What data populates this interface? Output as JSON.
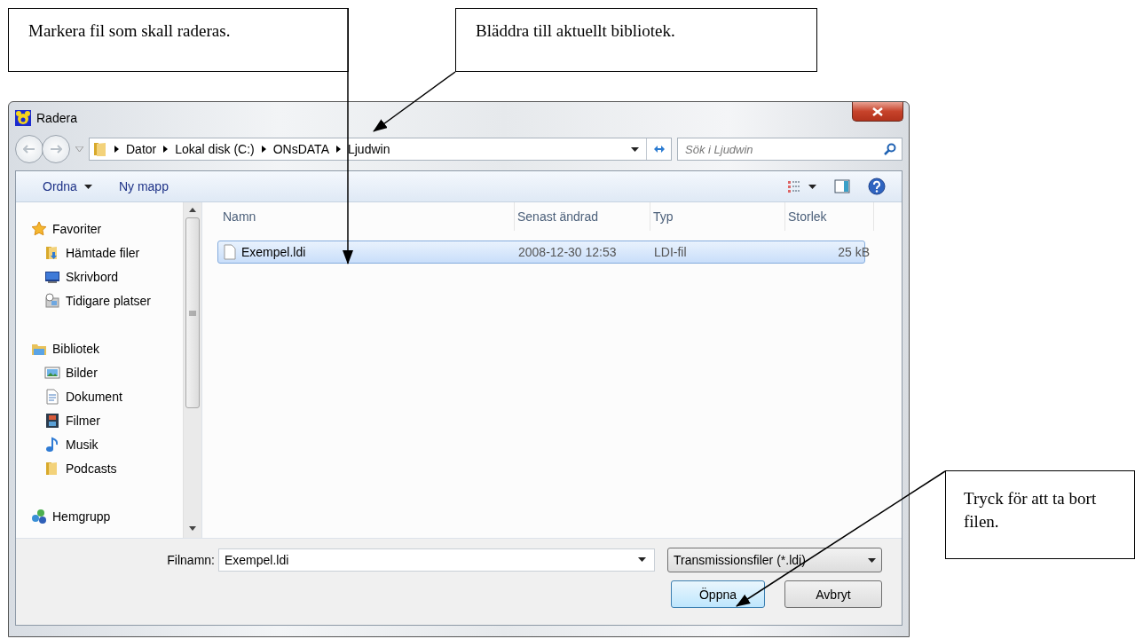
{
  "callouts": [
    {
      "text": "Markera fil som skall raderas."
    },
    {
      "text": "Bläddra till aktuellt bibliotek."
    },
    {
      "text": "Tryck för att ta bort filen."
    }
  ],
  "window": {
    "title": "Radera"
  },
  "address": {
    "crumbs": [
      "Dator",
      "Lokal disk (C:)",
      "ONsDATA",
      "Ljudwin"
    ]
  },
  "search": {
    "placeholder": "Sök i Ljudwin"
  },
  "toolbar": {
    "buttons": [
      "Ordna",
      "Ny mapp"
    ]
  },
  "sidebar": {
    "groups": [
      {
        "label": "Favoriter",
        "children": [
          {
            "label": "Hämtade filer"
          },
          {
            "label": "Skrivbord"
          },
          {
            "label": "Tidigare platser"
          }
        ]
      },
      {
        "label": "Bibliotek",
        "children": [
          {
            "label": "Bilder"
          },
          {
            "label": "Dokument"
          },
          {
            "label": "Filmer"
          },
          {
            "label": "Musik"
          },
          {
            "label": "Podcasts"
          }
        ]
      },
      {
        "label": "Hemgrupp"
      }
    ]
  },
  "table": {
    "columns": [
      "Namn",
      "Senast ändrad",
      "Typ",
      "Storlek"
    ],
    "rows": [
      {
        "cells": [
          "Exempel.ldi",
          "2008-12-30 12:53",
          "LDI-fil",
          "25 kB"
        ],
        "selected": true
      }
    ]
  },
  "footer": {
    "filename_label": "Filnamn:",
    "filename": "Exempel.ldi",
    "filetype": "Transmissionsfiler (*.ldi)",
    "buttons": [
      "Öppna",
      "Avbryt"
    ]
  }
}
